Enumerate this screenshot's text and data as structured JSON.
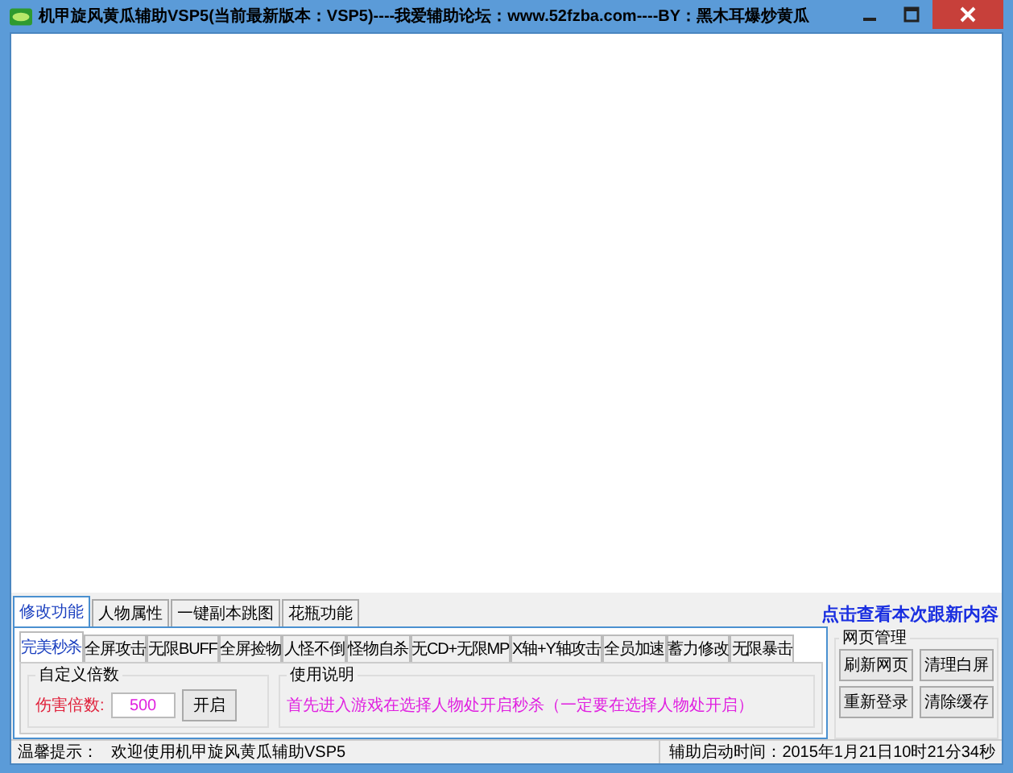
{
  "window": {
    "title": "机甲旋风黄瓜辅助VSP5(当前最新版本：VSP5)----我爱辅助论坛：www.52fzba.com----BY：黑木耳爆炒黄瓜"
  },
  "tabs": [
    {
      "label": "修改功能",
      "selected": true
    },
    {
      "label": "人物属性",
      "selected": false
    },
    {
      "label": "一键副本跳图",
      "selected": false
    },
    {
      "label": "花瓶功能",
      "selected": false
    }
  ],
  "update_link": "点击查看本次跟新内容",
  "sub_tabs": [
    {
      "label": "完美秒杀",
      "selected": true
    },
    {
      "label": "全屏攻击",
      "selected": false
    },
    {
      "label": "无限BUFF",
      "selected": false
    },
    {
      "label": "全屏捡物",
      "selected": false
    },
    {
      "label": "人怪不倒",
      "selected": false
    },
    {
      "label": "怪物自杀",
      "selected": false
    },
    {
      "label": "无CD+无限MP",
      "selected": false
    },
    {
      "label": "X轴+Y轴攻击",
      "selected": false
    },
    {
      "label": "全员加速",
      "selected": false
    },
    {
      "label": "蓄力修改",
      "selected": false
    },
    {
      "label": "无限暴击",
      "selected": false
    }
  ],
  "multiplier_group": {
    "title": "自定义倍数",
    "label": "伤害倍数:",
    "value": "500",
    "button": "开启"
  },
  "instructions_group": {
    "title": "使用说明",
    "text": "首先进入游戏在选择人物处开启秒杀（一定要在选择人物处开启）"
  },
  "web_group": {
    "title": "网页管理",
    "buttons": [
      "刷新网页",
      "清理白屏",
      "重新登录",
      "清除缓存"
    ]
  },
  "status_bar": {
    "label": "温馨提示：",
    "message": "欢迎使用机甲旋风黄瓜辅助VSP5",
    "start_time": "辅助启动时间：2015年1月21日10时21分34秒"
  }
}
